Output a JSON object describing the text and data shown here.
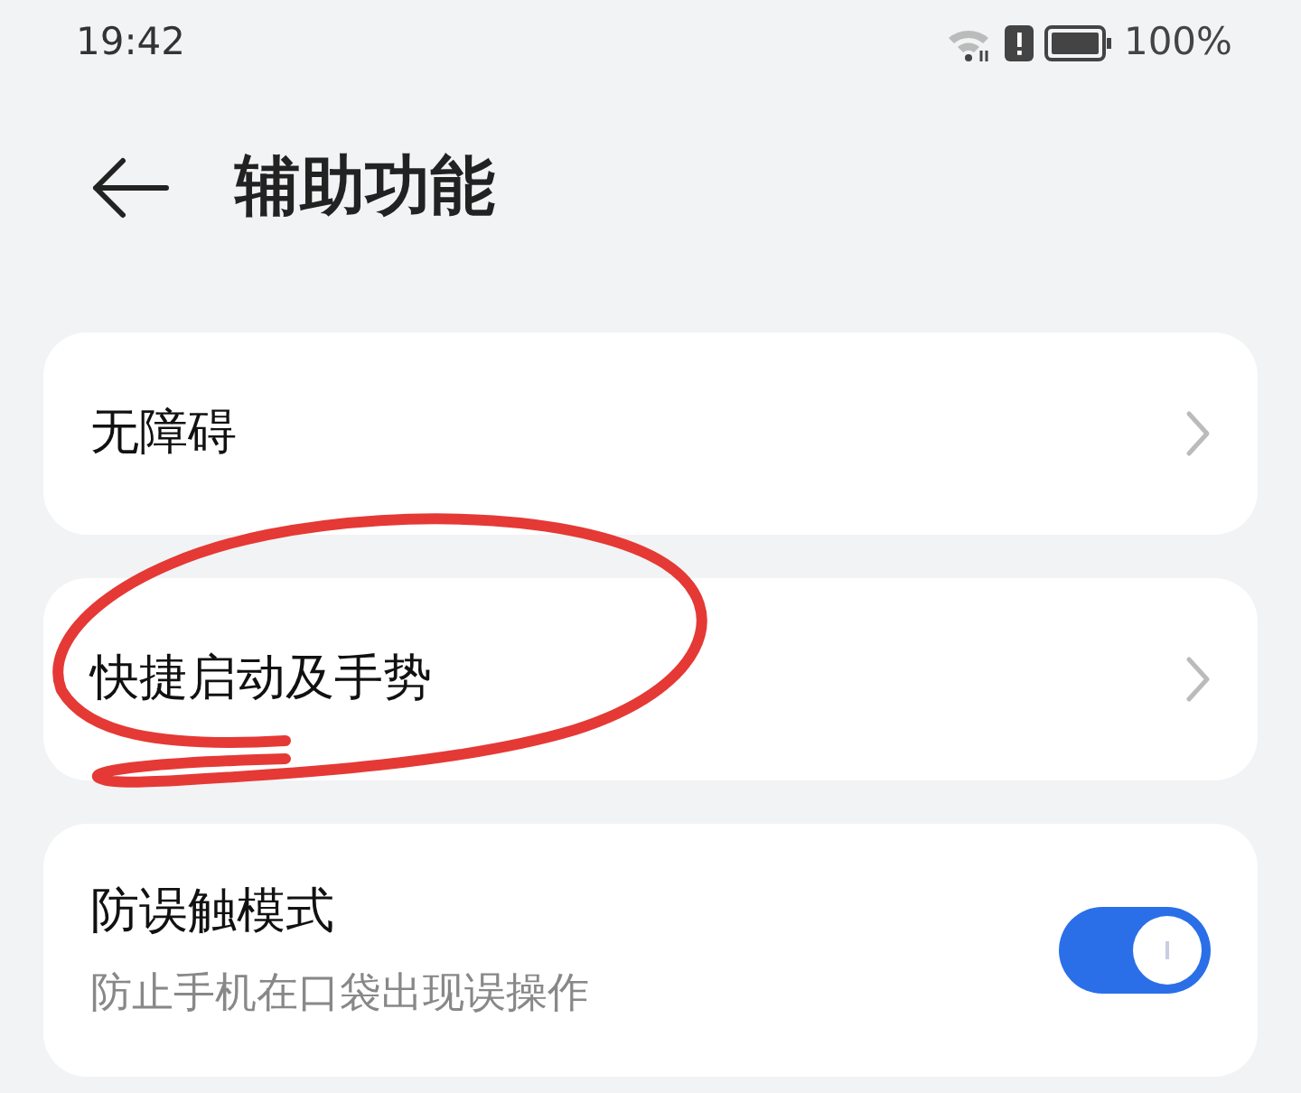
{
  "status_bar": {
    "time": "19:42",
    "battery": "100%"
  },
  "header": {
    "title": "辅助功能"
  },
  "items": [
    {
      "kind": "link",
      "title": "无障碍"
    },
    {
      "kind": "link",
      "title": "快捷启动及手势"
    },
    {
      "kind": "switch",
      "title": "防误触模式",
      "subtitle": "防止手机在口袋出现误操作",
      "on": true
    }
  ]
}
